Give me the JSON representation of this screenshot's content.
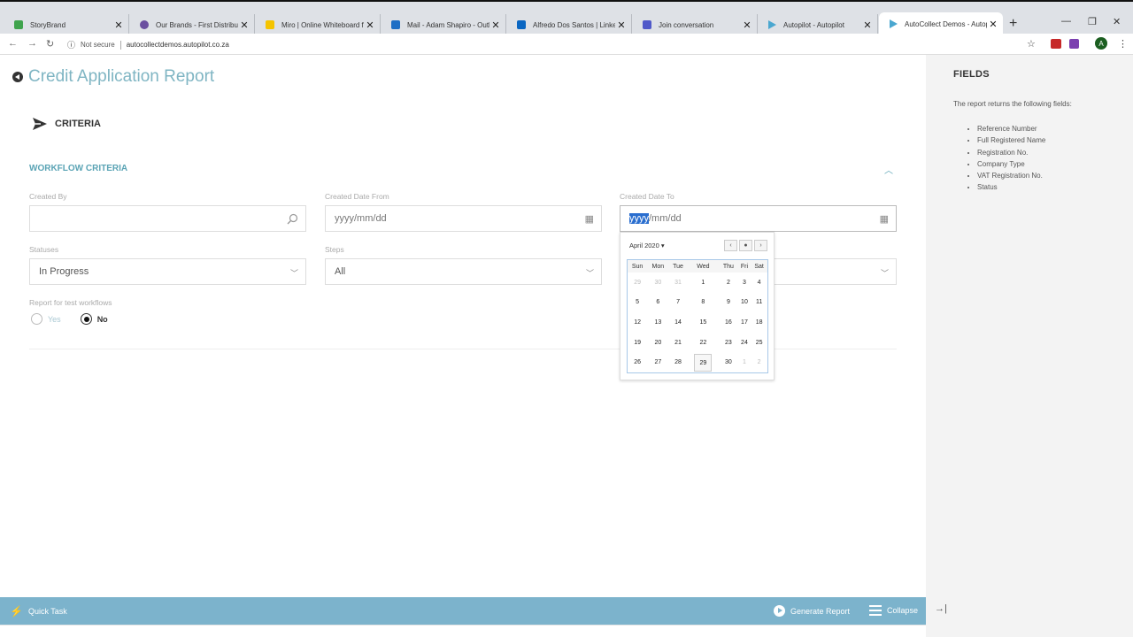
{
  "browser": {
    "tabs": [
      {
        "title": "StoryBrand",
        "color": "#3fa34d"
      },
      {
        "title": "Our Brands - First Distribut...",
        "color": "#6b4fa0"
      },
      {
        "title": "Miro | Online Whiteboard f...",
        "color": "#f5c400"
      },
      {
        "title": "Mail - Adam Shapiro - Outl...",
        "color": "#1f6fc5"
      },
      {
        "title": "Alfredo Dos Santos | Linked...",
        "color": "#0a66c2"
      },
      {
        "title": "Join conversation",
        "color": "#5059c9"
      },
      {
        "title": "Autopilot - Autopilot",
        "color": "#4aa7d0"
      },
      {
        "title": "AutoCollect Demos - Autop...",
        "color": "#4aa7d0"
      }
    ],
    "security": "Not secure",
    "url": "autocollectdemos.autopilot.co.za"
  },
  "page": {
    "title": "Credit Application Report",
    "criteria_label": "CRITERIA",
    "workflow_criteria_label": "WORKFLOW CRITERIA",
    "fields": {
      "created_by": {
        "label": "Created By",
        "value": ""
      },
      "created_date_from": {
        "label": "Created Date From",
        "placeholder": "yyyy/mm/dd"
      },
      "created_date_to": {
        "label": "Created Date To",
        "selected_part": "yyyy",
        "rest": "/mm/dd"
      },
      "statuses": {
        "label": "Statuses",
        "value": "In Progress"
      },
      "steps": {
        "label": "Steps",
        "value": "All"
      }
    },
    "test_workflows": {
      "label": "Report for test workflows",
      "yes": "Yes",
      "no": "No",
      "selected": "No"
    }
  },
  "calendar": {
    "month_label": "April 2020",
    "weekdays": [
      "Sun",
      "Mon",
      "Tue",
      "Wed",
      "Thu",
      "Fri",
      "Sat"
    ],
    "weeks": [
      [
        "29",
        "30",
        "31",
        "1",
        "2",
        "3",
        "4"
      ],
      [
        "5",
        "6",
        "7",
        "8",
        "9",
        "10",
        "11"
      ],
      [
        "12",
        "13",
        "14",
        "15",
        "16",
        "17",
        "18"
      ],
      [
        "19",
        "20",
        "21",
        "22",
        "23",
        "24",
        "25"
      ],
      [
        "26",
        "27",
        "28",
        "29",
        "30",
        "1",
        "2"
      ]
    ],
    "today": "29"
  },
  "side_panel": {
    "title": "FIELDS",
    "description": "The report returns the following fields:",
    "items": [
      "Reference Number",
      "Full Registered Name",
      "Registration No.",
      "Company Type",
      "VAT Registration No.",
      "Status"
    ]
  },
  "bottom_bar": {
    "quick_task": "Quick Task",
    "generate_report": "Generate Report",
    "collapse": "Collapse"
  },
  "colors": {
    "accent": "#5ba4b5",
    "title": "#7fb5c3",
    "bottom_bar": "#7cb3cc"
  }
}
